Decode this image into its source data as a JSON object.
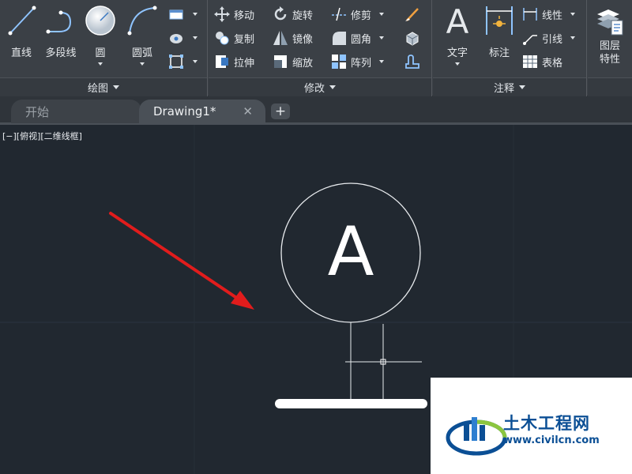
{
  "ribbon": {
    "draw": {
      "title": "绘图",
      "line": "直线",
      "polyline": "多段线",
      "circle": "圆",
      "arc": "圆弧"
    },
    "modify": {
      "title": "修改",
      "move": "移动",
      "rotate": "旋转",
      "trim": "修剪",
      "copy": "复制",
      "mirror": "镜像",
      "fillet": "圆角",
      "stretch": "拉伸",
      "scale": "缩放",
      "array": "阵列"
    },
    "annotation": {
      "title": "注释",
      "text": "文字",
      "dimension": "标注",
      "linear": "线性",
      "leader": "引线",
      "table": "表格"
    },
    "layers": {
      "properties": "图层\n特性"
    }
  },
  "tabs": {
    "start": "开始",
    "drawing": "Drawing1*",
    "close_glyph": "✕",
    "add_glyph": "+"
  },
  "canvas": {
    "viewport_label": "[−][俯视][二维线框]",
    "circle_letter": "A"
  },
  "watermark": {
    "name_cn": "土木工程网",
    "url": "www.civilcn.com"
  },
  "colors": {
    "ribbon_bg": "#3b4046",
    "canvas_bg": "#212830",
    "arrow_red": "#e11c1c",
    "watermark_blue": "#0b4f95"
  },
  "icons": {
    "line": "line-icon",
    "polyline": "polyline-icon",
    "circle": "circle-icon",
    "arc": "arc-icon",
    "move": "move-icon",
    "rotate": "rotate-icon",
    "trim": "trim-icon",
    "copy": "copy-icon",
    "mirror": "mirror-icon",
    "fillet": "fillet-icon",
    "stretch": "stretch-icon",
    "scale": "scale-icon",
    "array": "array-icon",
    "text": "text-icon",
    "dimension": "dimension-icon",
    "linear": "linear-dimension-icon",
    "leader": "leader-icon",
    "table": "table-icon",
    "layers": "layer-properties-icon"
  }
}
